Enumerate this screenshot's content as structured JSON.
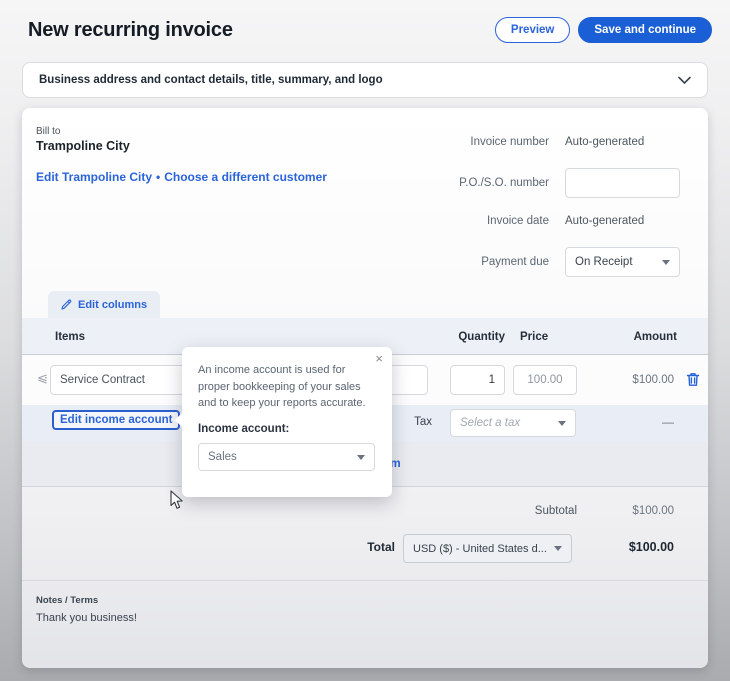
{
  "page": {
    "title": "New recurring invoice",
    "preview_label": "Preview",
    "save_label": "Save and continue"
  },
  "accordion": {
    "label": "Business address and contact details, title, summary, and logo"
  },
  "bill_to": {
    "label": "Bill to",
    "customer_name": "Trampoline City",
    "edit_link": "Edit Trampoline City",
    "separator": "•",
    "choose_link": "Choose a different customer"
  },
  "invoice_fields": {
    "invoice_number_label": "Invoice number",
    "invoice_number_value": "Auto-generated",
    "po_number_label": "P.O./S.O. number",
    "po_number_value": "",
    "invoice_date_label": "Invoice date",
    "invoice_date_value": "Auto-generated",
    "payment_due_label": "Payment due",
    "payment_due_value": "On Receipt"
  },
  "items_table": {
    "edit_columns_label": "Edit columns",
    "headers": {
      "items": "Items",
      "quantity": "Quantity",
      "price": "Price",
      "amount": "Amount"
    },
    "row": {
      "description": "Service Contract",
      "quantity": "1",
      "price": "100.00",
      "amount": "$100.00"
    },
    "edit_income_account_label": "Edit income account",
    "tax_label": "Tax",
    "tax_placeholder": "Select a tax",
    "tax_amount": "—",
    "add_item_label": "Add an item"
  },
  "tooltip": {
    "close": "×",
    "body": "An income account is used for proper bookkeeping of your sales and to keep your reports accurate.",
    "income_account_label": "Income account:",
    "income_account_value": "Sales"
  },
  "totals": {
    "subtotal_label": "Subtotal",
    "subtotal_value": "$100.00",
    "total_label": "Total",
    "currency_value": "USD ($) - United States d...",
    "total_value": "$100.00"
  },
  "notes": {
    "label": "Notes / Terms",
    "value": "Thank you business!"
  },
  "colors": {
    "accent_blue": "#1a5fd6",
    "link_blue": "#2b63d9",
    "band_bg": "#e9edf5",
    "header_bg": "#edf0f6"
  }
}
